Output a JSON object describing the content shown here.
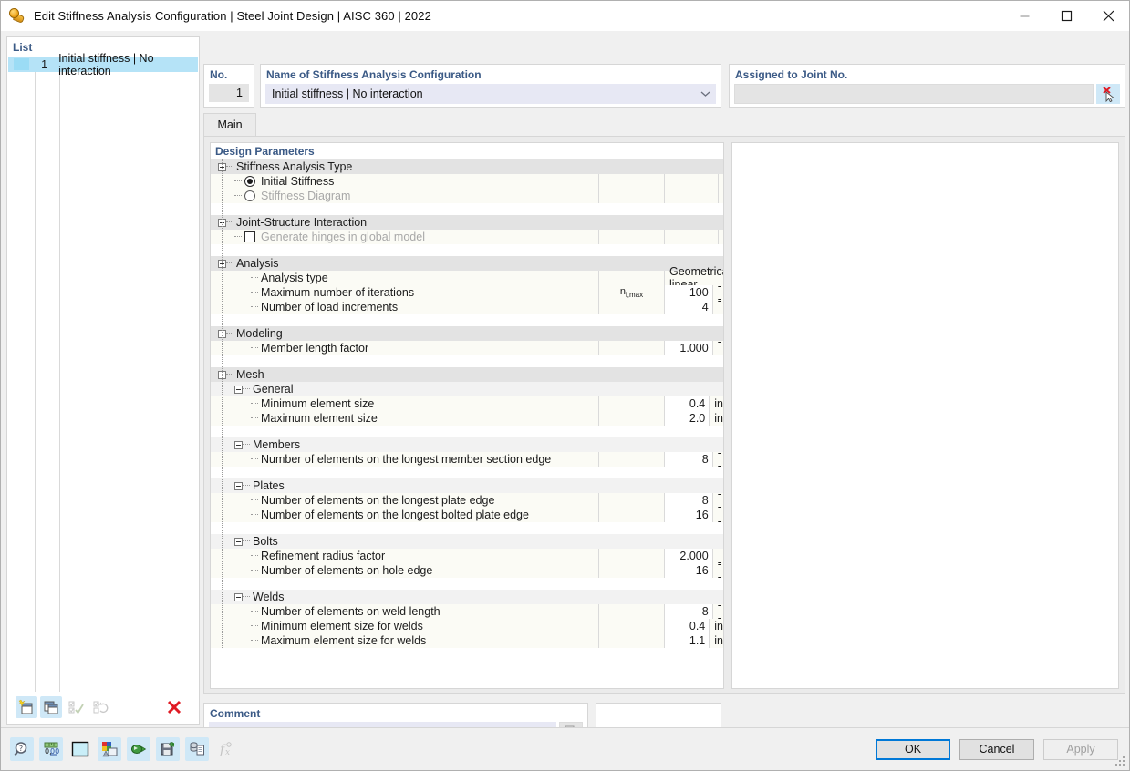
{
  "window": {
    "title": "Edit Stiffness Analysis Configuration | Steel Joint Design | AISC 360 | 2022",
    "icon": "bolt-icon",
    "minimize": "minimize",
    "maximize": "maximize",
    "close": "close"
  },
  "list": {
    "title": "List",
    "rows": [
      {
        "no": "1",
        "label": "Initial stiffness | No interaction"
      }
    ],
    "toolbar": [
      {
        "name": "new-item",
        "state": "enabled"
      },
      {
        "name": "copy-item",
        "state": "enabled"
      },
      {
        "name": "select-all",
        "state": "disabled"
      },
      {
        "name": "invert-selection",
        "state": "disabled"
      },
      {
        "name": "delete-item",
        "state": "enabled"
      }
    ]
  },
  "no_panel": {
    "title": "No.",
    "value": "1"
  },
  "name_panel": {
    "title": "Name of Stiffness Analysis Configuration",
    "value": "Initial stiffness | No interaction"
  },
  "assigned_panel": {
    "title": "Assigned to Joint No.",
    "value": "",
    "button": "pick-joint"
  },
  "tabs": [
    {
      "label": "Main",
      "active": true
    }
  ],
  "grid": {
    "title": "Design Parameters",
    "rows": [
      {
        "kind": "group1",
        "label": "Stiffness Analysis Type"
      },
      {
        "kind": "radio",
        "label": "Initial Stiffness",
        "checked": true,
        "dim": false
      },
      {
        "kind": "radio",
        "label": "Stiffness Diagram",
        "checked": false,
        "dim": true
      },
      {
        "kind": "spacer"
      },
      {
        "kind": "group1",
        "label": "Joint-Structure Interaction"
      },
      {
        "kind": "check",
        "label": "Generate hinges in global model",
        "checked": false,
        "dim": true
      },
      {
        "kind": "spacer"
      },
      {
        "kind": "group1",
        "label": "Analysis"
      },
      {
        "kind": "textvalue",
        "label": "Analysis type",
        "symbol": "",
        "value": "Geometrically linear"
      },
      {
        "kind": "data",
        "label": "Maximum number of iterations",
        "symbol": "n",
        "symbol_sub": "i,max",
        "value": "100",
        "unit": "--"
      },
      {
        "kind": "data",
        "label": "Number of load increments",
        "symbol": "",
        "value": "4",
        "unit": "--"
      },
      {
        "kind": "spacer"
      },
      {
        "kind": "group1",
        "label": "Modeling"
      },
      {
        "kind": "data",
        "label": "Member length factor",
        "symbol": "",
        "value": "1.000",
        "unit": "--"
      },
      {
        "kind": "spacer"
      },
      {
        "kind": "group1",
        "label": "Mesh"
      },
      {
        "kind": "group2",
        "label": "General"
      },
      {
        "kind": "data",
        "label": "Minimum element size",
        "symbol": "",
        "value": "0.4",
        "unit": "in"
      },
      {
        "kind": "data",
        "label": "Maximum element size",
        "symbol": "",
        "value": "2.0",
        "unit": "in"
      },
      {
        "kind": "spacer"
      },
      {
        "kind": "group2",
        "label": "Members"
      },
      {
        "kind": "data",
        "label": "Number of elements on the longest member section edge",
        "symbol": "",
        "value": "8",
        "unit": "--"
      },
      {
        "kind": "spacer"
      },
      {
        "kind": "group2",
        "label": "Plates"
      },
      {
        "kind": "data",
        "label": "Number of elements on the longest plate edge",
        "symbol": "",
        "value": "8",
        "unit": "--"
      },
      {
        "kind": "data",
        "label": "Number of elements on the longest bolted plate edge",
        "symbol": "",
        "value": "16",
        "unit": "--"
      },
      {
        "kind": "spacer"
      },
      {
        "kind": "group2",
        "label": "Bolts"
      },
      {
        "kind": "data",
        "label": "Refinement radius factor",
        "symbol": "",
        "value": "2.000",
        "unit": "--"
      },
      {
        "kind": "data",
        "label": "Number of elements on hole edge",
        "symbol": "",
        "value": "16",
        "unit": "--"
      },
      {
        "kind": "spacer"
      },
      {
        "kind": "group2",
        "label": "Welds"
      },
      {
        "kind": "data",
        "label": "Number of elements on weld length",
        "symbol": "",
        "value": "8",
        "unit": "--"
      },
      {
        "kind": "data",
        "label": "Minimum element size for welds",
        "symbol": "",
        "value": "0.4",
        "unit": "in"
      },
      {
        "kind": "data",
        "label": "Maximum element size for welds",
        "symbol": "",
        "value": "1.1",
        "unit": "in"
      }
    ]
  },
  "comment": {
    "title": "Comment",
    "value": "",
    "button": "comment-templates"
  },
  "bottom_tools": [
    {
      "name": "help-magnifier-icon",
      "state": "enabled"
    },
    {
      "name": "decimal-places-icon",
      "state": "enabled"
    },
    {
      "name": "color-swatch-icon",
      "state": "enabled"
    },
    {
      "name": "display-properties-icon",
      "state": "enabled"
    },
    {
      "name": "import-icon",
      "state": "enabled"
    },
    {
      "name": "export-icon",
      "state": "enabled"
    },
    {
      "name": "copy-settings-icon",
      "state": "enabled"
    },
    {
      "name": "formula-icon",
      "state": "disabled"
    }
  ],
  "dialog_buttons": {
    "ok": "OK",
    "cancel": "Cancel",
    "apply": "Apply"
  },
  "colors": {
    "accent": "#0078d7",
    "panel_title": "#3b5a86",
    "selection": "#b5e3f7",
    "field": "#e7e8f4",
    "delete": "#e01b24"
  }
}
